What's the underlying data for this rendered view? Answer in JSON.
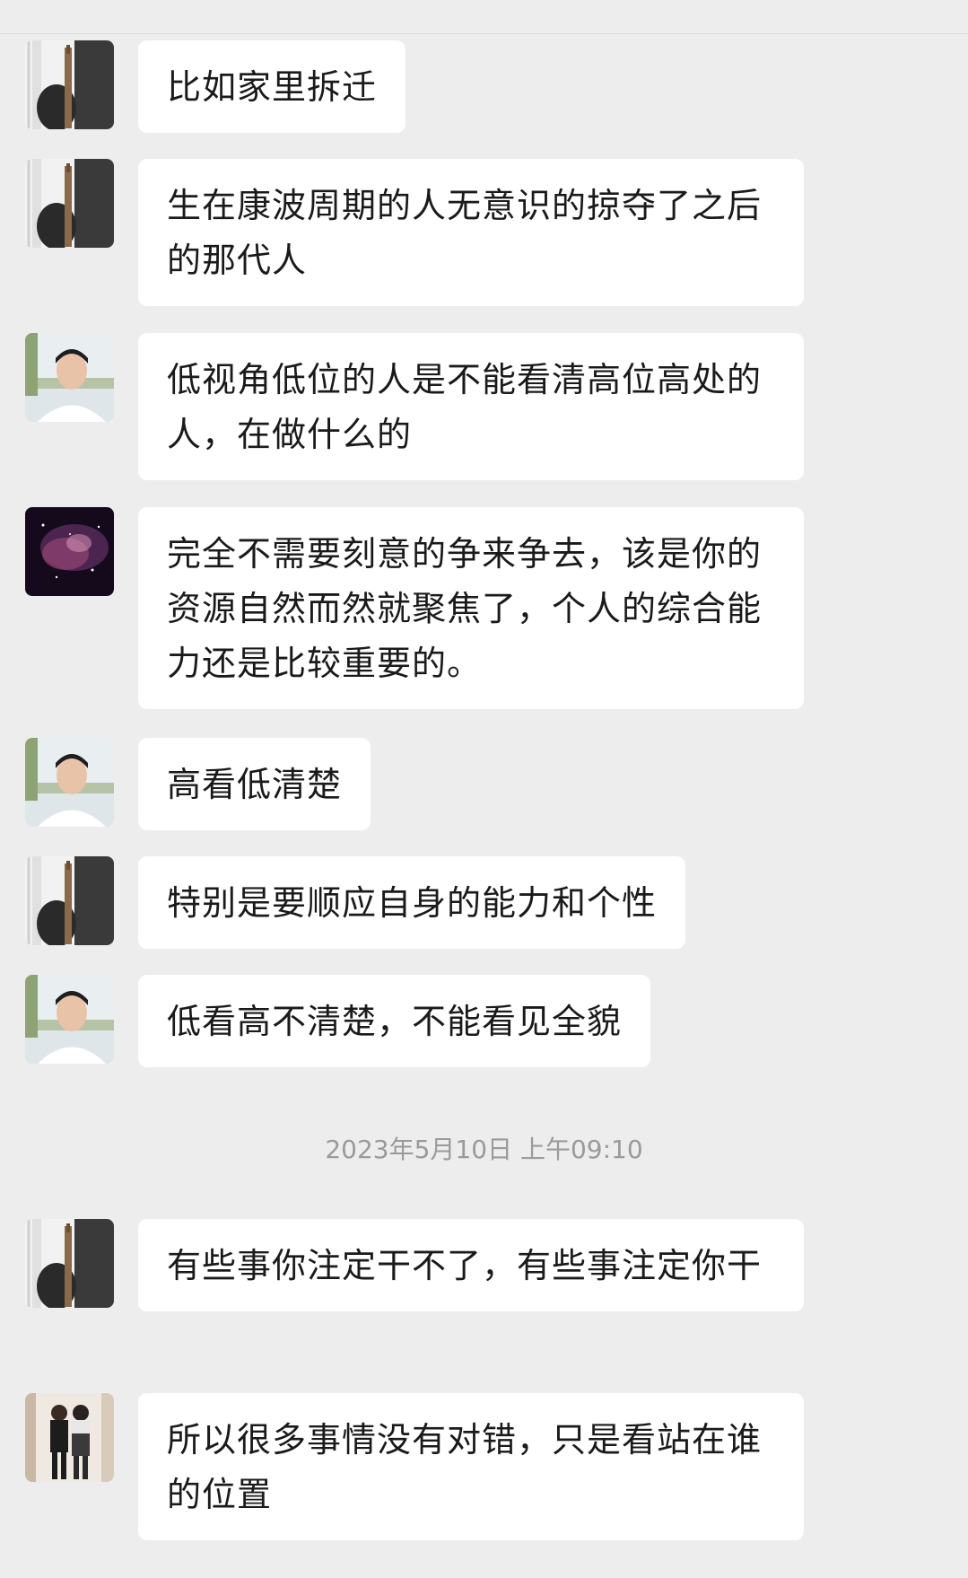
{
  "messages": [
    {
      "avatar": "cat-avatar-icon",
      "text": "比如家里拆迁"
    },
    {
      "avatar": "cat-avatar-icon",
      "text": "生在康波周期的人无意识的掠夺了之后的那代人"
    },
    {
      "avatar": "young-man-avatar-icon",
      "text": "低视角低位的人是不能看清高位高处的人，在做什么的"
    },
    {
      "avatar": "galaxy-avatar-icon",
      "text": "完全不需要刻意的争来争去，该是你的资源自然而然就聚焦了，个人的综合能力还是比较重要的。"
    },
    {
      "avatar": "young-man-avatar-icon",
      "text": "高看低清楚"
    },
    {
      "avatar": "cat-avatar-icon",
      "text": "特别是要顺应自身的能力和个性"
    },
    {
      "avatar": "young-man-avatar-icon",
      "text": "低看高不清楚，不能看见全貌"
    },
    {
      "avatar": "cat-avatar-icon",
      "text": "有些事你注定干不了，有些事注定你干"
    },
    {
      "avatar": "couple-photo-avatar-icon",
      "text": "所以很多事情没有对错，只是看站在谁的位置"
    }
  ],
  "timestamp": "2023年5月10日 上午09:10",
  "colors": {
    "background": "#ededed",
    "bubble": "#ffffff",
    "text": "#1a1a1a",
    "timestamp": "#9a9a9a"
  }
}
